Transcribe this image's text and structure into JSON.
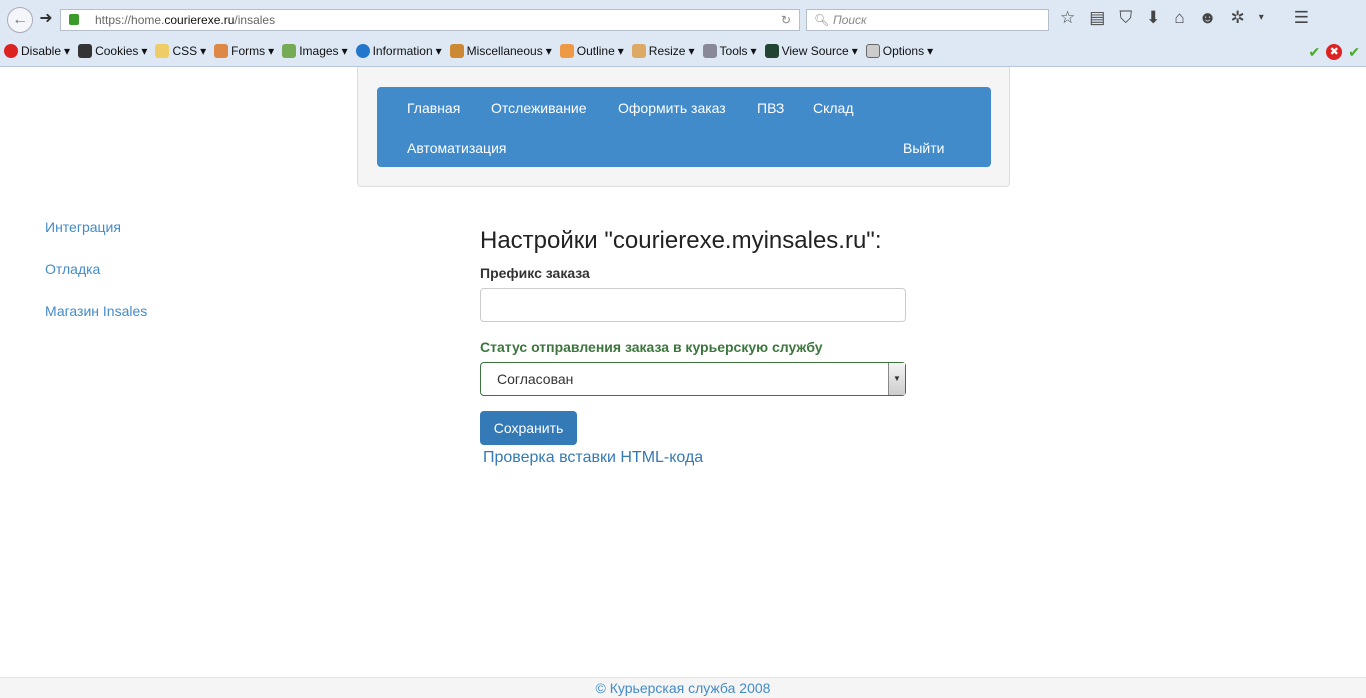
{
  "browser": {
    "url_prefix": "https://home.",
    "url_domain": "courierexe.ru",
    "url_path": "/insales",
    "search_placeholder": "Поиск",
    "devbar": [
      "Disable",
      "Cookies",
      "CSS",
      "Forms",
      "Images",
      "Information",
      "Miscellaneous",
      "Outline",
      "Resize",
      "Tools",
      "View Source",
      "Options"
    ]
  },
  "nav": {
    "items": [
      "Главная",
      "Отслеживание",
      "Оформить заказ",
      "ПВЗ",
      "Склад",
      "Автоматизация"
    ],
    "logout": "Выйти"
  },
  "sidebar": [
    "Интеграция",
    "Отладка",
    "Магазин Insales"
  ],
  "form": {
    "title": "Настройки \"courierexe.myinsales.ru\":",
    "prefix_label": "Префикс заказа",
    "prefix_value": "",
    "status_label": "Статус отправления заказа в курьерскую службу",
    "status_value": "Согласован",
    "save": "Сохранить",
    "check_link": "Проверка вставки HTML-кода"
  },
  "footer": "© Курьерская служба 2008"
}
